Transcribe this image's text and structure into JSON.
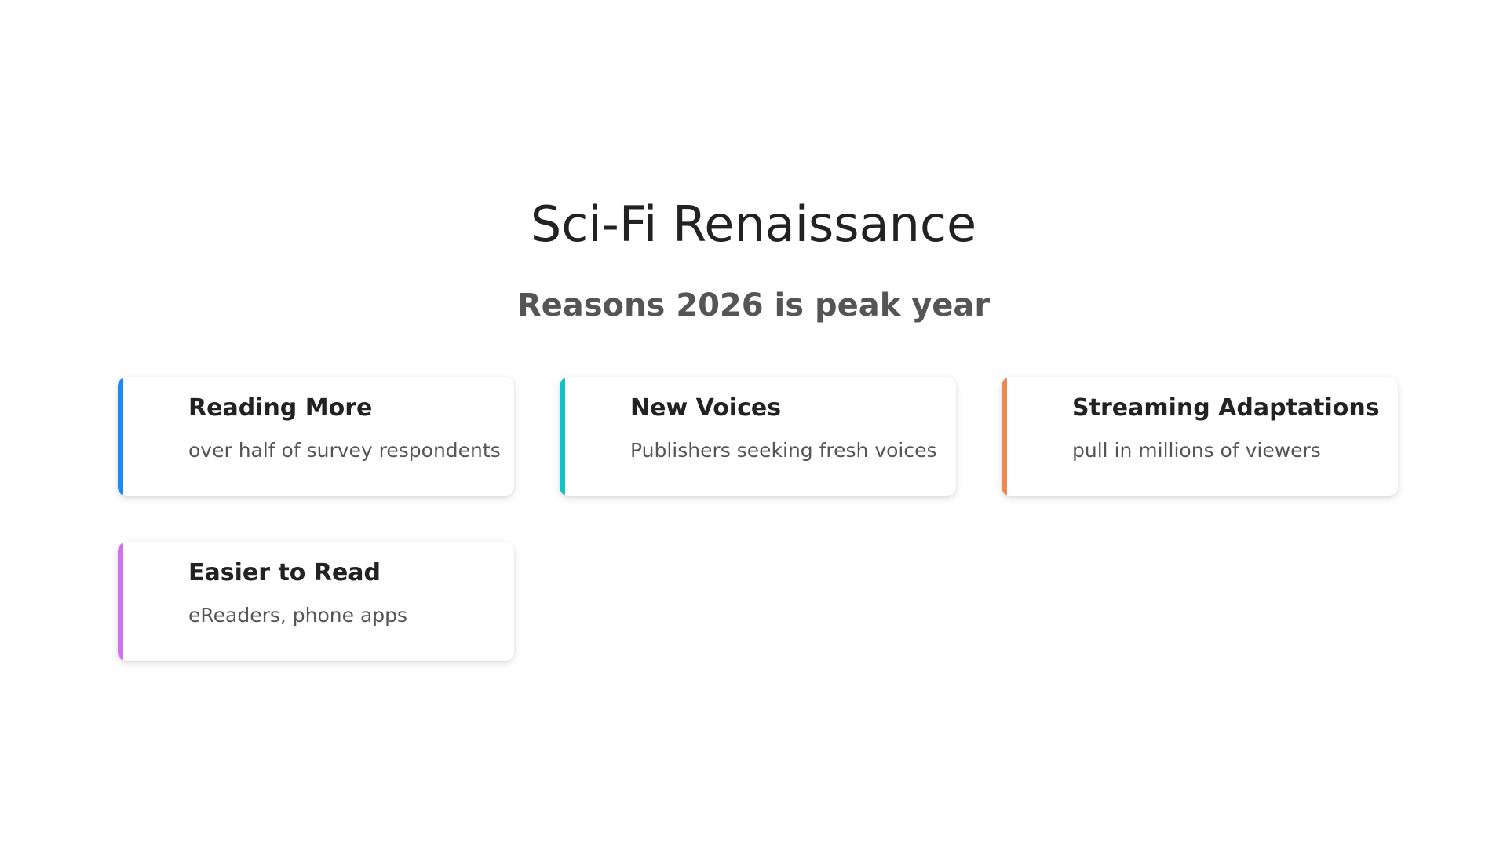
{
  "slide": {
    "title": "Sci-Fi Renaissance",
    "subtitle": "Reasons 2026 is peak year"
  },
  "cards": [
    {
      "title": "Reading More",
      "text": "over half of survey respondents",
      "accent": "#1e88f2"
    },
    {
      "title": "New Voices",
      "text": "Publishers seeking fresh voices",
      "accent": "#12c4c4"
    },
    {
      "title": "Streaming Adaptations",
      "text": "pull in millions of viewers",
      "accent": "#f0874f"
    },
    {
      "title": "Easier to Read",
      "text": "eReaders, phone apps",
      "accent": "#cf72f0"
    }
  ]
}
